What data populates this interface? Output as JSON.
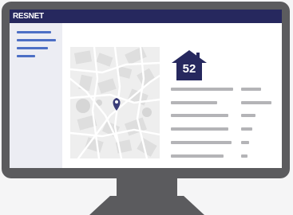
{
  "header": {
    "brand": "RESNET",
    "brand_color": "#26285e"
  },
  "sidebar": {
    "items": [
      "menu-line-1",
      "menu-line-2",
      "menu-line-3",
      "menu-line-4"
    ],
    "accent_color": "#4d6fc5"
  },
  "main": {
    "map": {
      "pin_icon": "map-pin-icon",
      "pin_color": "#3a3d78"
    },
    "score": {
      "value": "52",
      "icon": "house-icon",
      "color": "#26285e"
    },
    "details_rows": 6
  }
}
